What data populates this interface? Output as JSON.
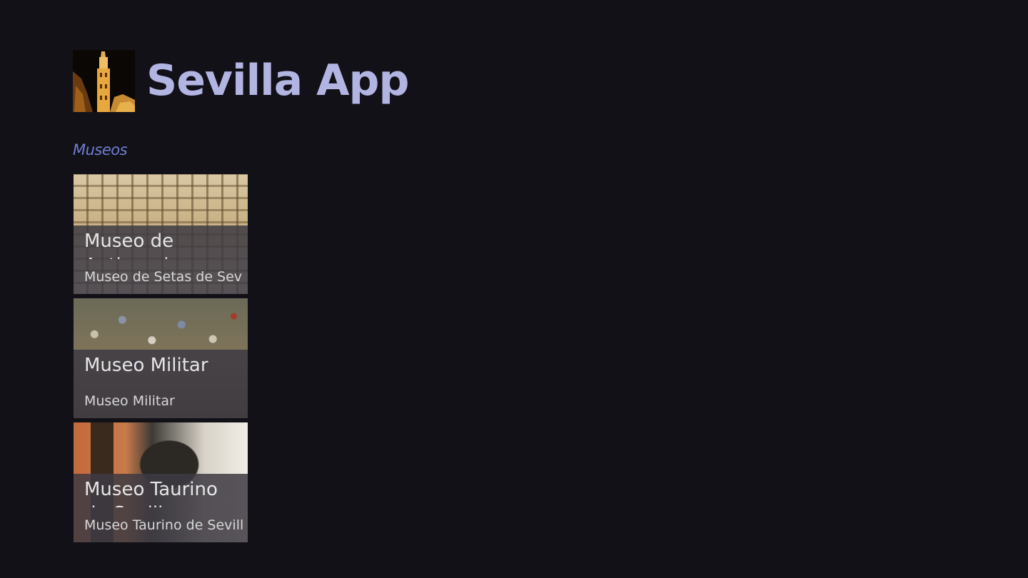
{
  "app": {
    "title": "Sevilla App",
    "logo_icon": "giralda-tower-icon"
  },
  "section": {
    "title": "Museos"
  },
  "tiles": [
    {
      "title": "Museo de Antiquarium",
      "subtitle": "Museo de Setas de Sevilla",
      "image": "metropol-parasol-photo"
    },
    {
      "title": "Museo Militar",
      "subtitle": "Museo Militar",
      "image": "toy-soldiers-diorama-photo"
    },
    {
      "title": "Museo Taurino de Sevilla",
      "subtitle": "Museo Taurino de Sevilla",
      "image": "bull-statue-photo"
    }
  ],
  "colors": {
    "background": "#121118",
    "title": "#b2b4e2",
    "section": "#6f7ed0",
    "overlay": "#3e3a42"
  }
}
